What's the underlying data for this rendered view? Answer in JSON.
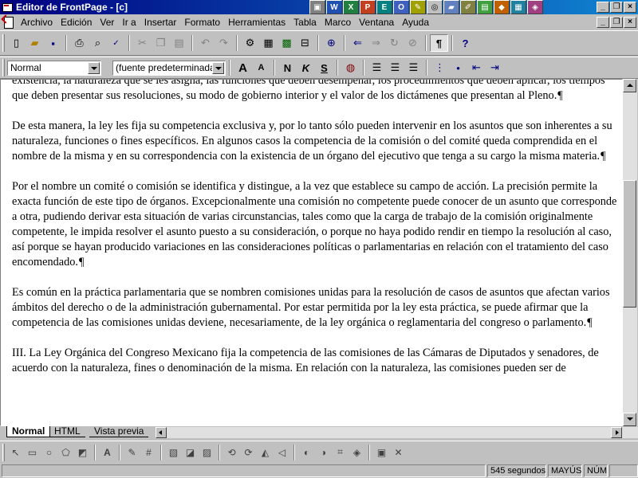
{
  "window": {
    "title": "Editor de FrontPage - [c]"
  },
  "menu": {
    "items": [
      "Archivo",
      "Edición",
      "Ver",
      "Ir a",
      "Insertar",
      "Formato",
      "Herramientas",
      "Tabla",
      "Marco",
      "Ventana",
      "Ayuda"
    ]
  },
  "format_toolbar": {
    "style_value": "Normal",
    "font_value": "(fuente predeterminada)"
  },
  "document": {
    "paragraphs": [
      "existencia, la naturaleza que se les asigna, las funciones que deben desempeñar, los procedimientos que deben aplicar, los tiempos que deben presentar sus resoluciones, su modo de gobierno interior y el valor de los dictámenes que presentan al Pleno.",
      "De esta manera, la ley les fija su competencia exclusiva y, por lo tanto sólo pueden intervenir en los asuntos que son inherentes a su naturaleza, funciones o fines específicos. En algunos casos la competencia de la comisión o del comité queda comprendida en el nombre de la misma y en su correspondencia con la existencia de un órgano del ejecutivo que tenga a su cargo la misma materia.",
      "Por el nombre un comité o comisión se identifica y distingue, a la vez que establece su campo de acción. La precisión permite la exacta función de este tipo de órganos. Excepcionalmente una comisión no competente puede conocer de un asunto que corresponde a otra, pudiendo derivar esta situación de varias circunstancias, tales como que la carga de trabajo de la comisión originalmente competente, le impida resolver el asunto puesto a su consideración, o porque no haya podido rendir en tiempo la resolución al caso, así porque se hayan producido variaciones en las consideraciones políticas o parlamentarias en relación con el tratamiento del caso encomendado.",
      "Es común en la práctica parlamentaria que se nombren comisiones unidas para la resolución de casos de asuntos que afectan varios ámbitos del derecho o de la administración gubernamental. Por estar permitida por la ley esta práctica, se puede afirmar que la competencia de las comisiones unidas deviene, necesariamente, de la ley orgánica o reglamentaria del congreso o parlamento.",
      "III. La Ley Orgánica del Congreso Mexicano fija la competencia de las comisiones de las Cámaras de Diputados y senadores, de acuerdo con la naturaleza, fines o denominación de la misma. En relación con la naturaleza, las comisiones pueden ser de"
    ],
    "pilcrow": "¶"
  },
  "tabs": [
    "Normal",
    "HTML",
    "Vista previa"
  ],
  "status": {
    "time": "545 segundos",
    "caps": "MAYÚS",
    "num": "NÚM"
  }
}
